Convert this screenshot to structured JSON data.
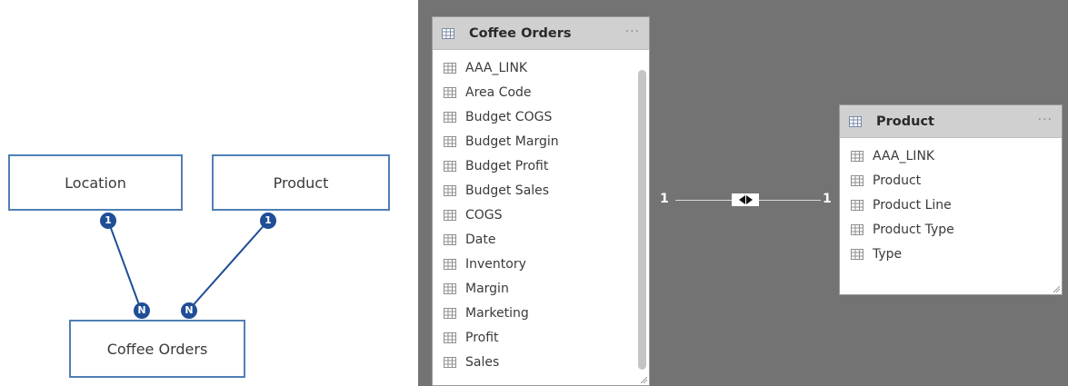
{
  "schema": {
    "tables": {
      "location": {
        "label": "Location"
      },
      "product": {
        "label": "Product"
      },
      "orders": {
        "label": "Coffee Orders"
      }
    },
    "links": [
      {
        "from": "Location",
        "to": "Coffee Orders",
        "from_card": "1",
        "to_card": "N"
      },
      {
        "from": "Product",
        "to": "Coffee Orders",
        "from_card": "1",
        "to_card": "N"
      }
    ]
  },
  "model": {
    "coffee_orders": {
      "title": "Coffee Orders",
      "menu": "···",
      "fields": [
        "AAA_LINK",
        "Area Code",
        "Budget COGS",
        "Budget Margin",
        "Budget Profit",
        "Budget Sales",
        "COGS",
        "Date",
        "Inventory",
        "Margin",
        "Marketing",
        "Profit",
        "Sales"
      ]
    },
    "product": {
      "title": "Product",
      "menu": "···",
      "fields": [
        "AAA_LINK",
        "Product",
        "Product Line",
        "Product Type",
        "Type"
      ]
    },
    "relationship": {
      "left_cardinality": "1",
      "right_cardinality": "1",
      "direction": "both"
    }
  },
  "colors": {
    "schema_border": "#4f7fb6",
    "badge": "#1f4e97",
    "canvas": "#737373",
    "header": "#d0d0d0"
  }
}
